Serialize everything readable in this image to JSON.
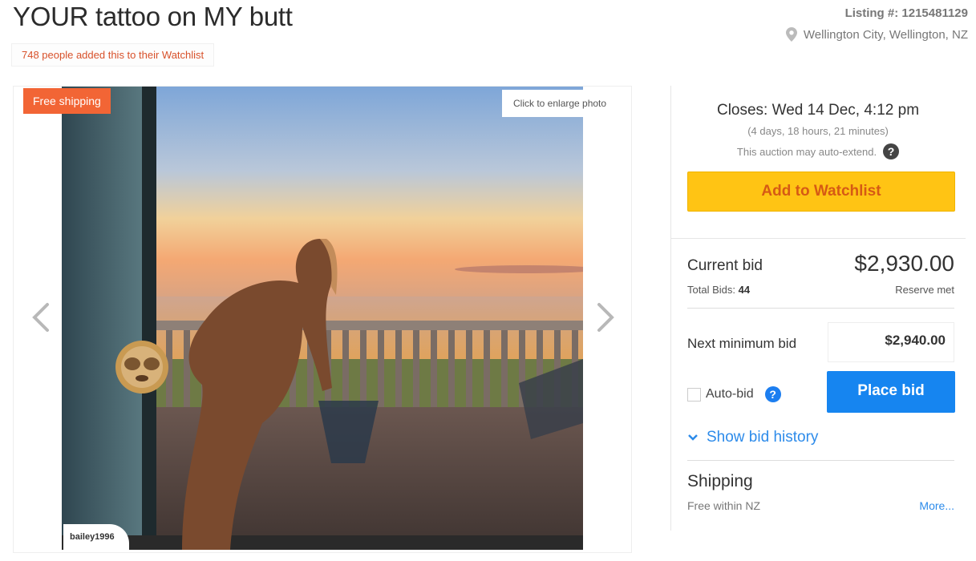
{
  "listing": {
    "title": "YOUR tattoo on MY butt",
    "watchlist_count": "748 people added this to their Watchlist",
    "listing_number": "Listing #: 1215481129",
    "location": "Wellington City, Wellington, NZ"
  },
  "photo": {
    "badge": "Free shipping",
    "enlarge": "Click to enlarge photo",
    "seller": "bailey1996"
  },
  "auction": {
    "closes": "Closes: Wed 14 Dec, 4:12 pm",
    "time_left": "(4 days, 18 hours, 21 minutes)",
    "auto_extend": "This auction may auto-extend.",
    "watchlist_button": "Add to Watchlist"
  },
  "bid": {
    "current_label": "Current bid",
    "current_value": "$2,930.00",
    "total_bids_label": "Total Bids:",
    "total_bids_value": "44",
    "reserve": "Reserve met",
    "next_min_label": "Next minimum bid",
    "next_min_value": "$2,940.00",
    "autobid_label": "Auto-bid",
    "place_bid": "Place bid",
    "show_history": "Show bid history"
  },
  "shipping": {
    "title": "Shipping",
    "value": "Free within NZ",
    "more": "More..."
  },
  "colors": {
    "accent_orange": "#f26535",
    "watch_yellow": "#ffc414",
    "bid_blue": "#1685f0",
    "link_blue": "#2d8bea"
  }
}
